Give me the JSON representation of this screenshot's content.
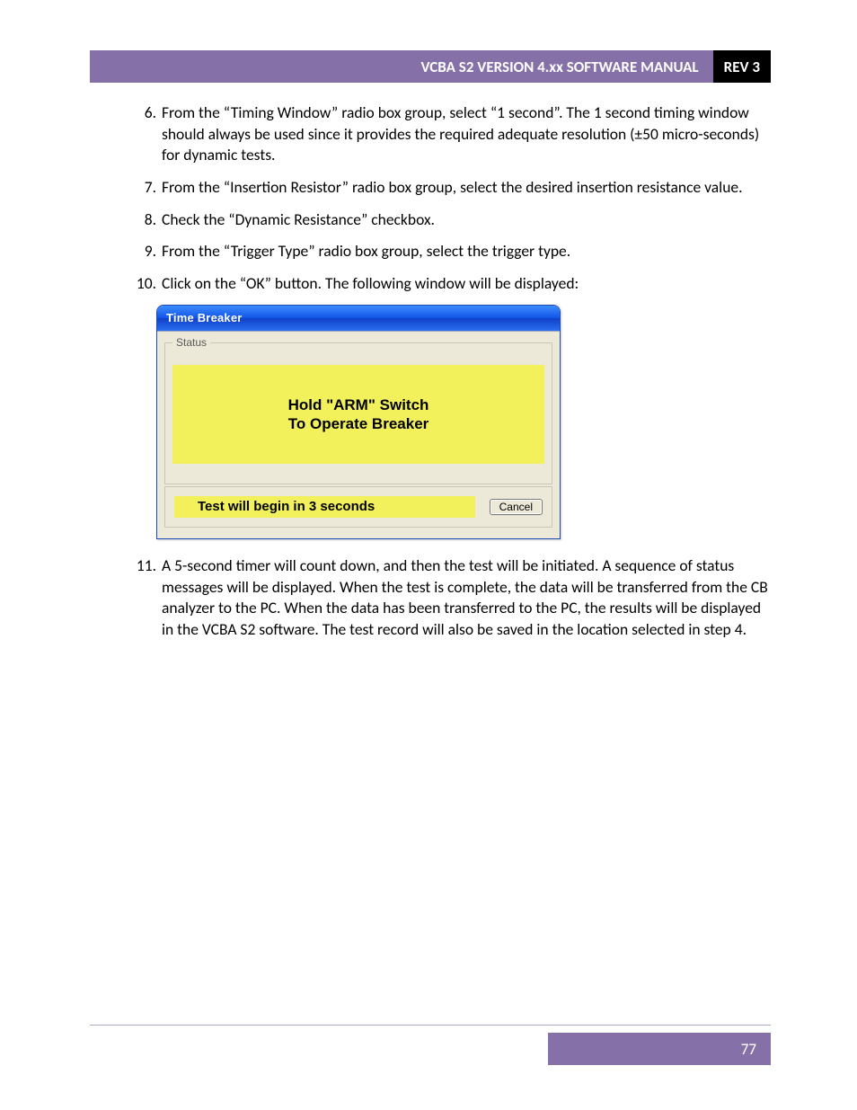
{
  "header": {
    "title": "VCBA S2 VERSION 4.xx SOFTWARE MANUAL",
    "rev": "REV 3"
  },
  "steps": [
    {
      "n": "6.",
      "text": "From the “Timing Window” radio box group, select “1 second”. The 1 second timing window should always be used since it provides the required adequate resolution (±50 micro-seconds) for dynamic tests."
    },
    {
      "n": "7.",
      "text": "From the “Insertion Resistor” radio box group, select the desired insertion resistance value."
    },
    {
      "n": "8.",
      "text": "Check the “Dynamic Resistance” checkbox."
    },
    {
      "n": "9.",
      "text": "From the “Trigger Type” radio box group, select the trigger type."
    },
    {
      "n": "10.",
      "text": "Click on the “OK” button. The following window will be displayed:"
    },
    {
      "n": "11.",
      "text": "A 5-second timer will count down, and then the test will be initiated. A sequence of status messages will be displayed. When the test is complete, the data will be transferred from the CB analyzer to the PC. When the data has been transferred to the PC, the results will be displayed in the VCBA S2 software. The test record will also be saved in the location selected in step 4."
    }
  ],
  "dialog": {
    "title": "Time Breaker",
    "status_legend": "Status",
    "msg_line1": "Hold \"ARM\" Switch",
    "msg_line2": "To Operate Breaker",
    "countdown_text": "Test will begin in 3 seconds",
    "cancel_label": "Cancel"
  },
  "footer": {
    "page_number": "77"
  }
}
